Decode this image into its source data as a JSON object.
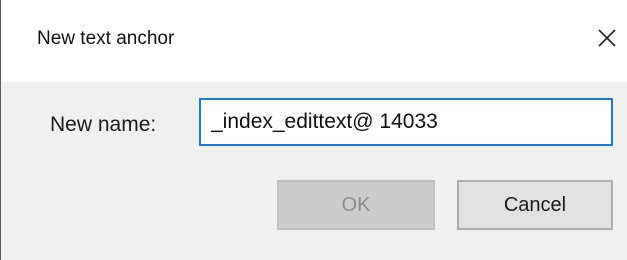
{
  "window": {
    "title": "New text anchor",
    "close_icon": "close-icon"
  },
  "form": {
    "name_label": "New name:",
    "name_value": "_index_edittext@ 14033"
  },
  "buttons": {
    "ok_label": "OK",
    "ok_enabled": false,
    "cancel_label": "Cancel"
  },
  "colors": {
    "input_focus_border": "#1a78d6",
    "disabled_text": "#8c8c8c"
  }
}
